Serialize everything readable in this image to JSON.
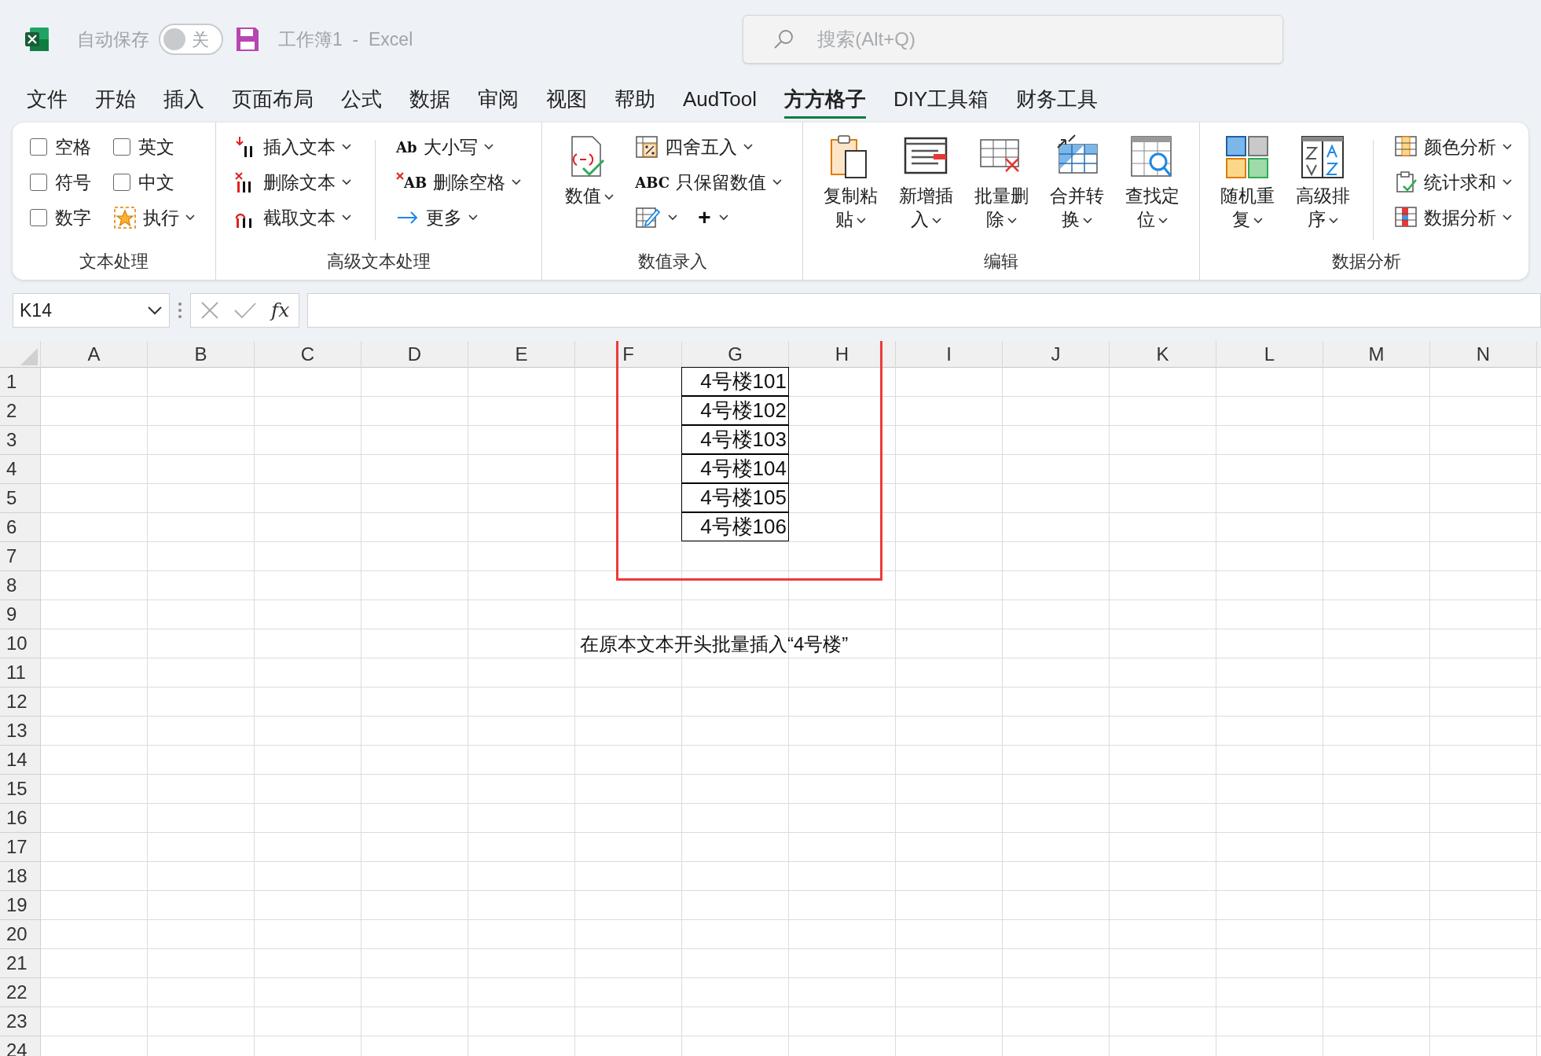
{
  "title_bar": {
    "autosave_label": "自动保存",
    "autosave_toggle": {
      "label": "关",
      "on": false
    },
    "document_title": "工作簿1  -  Excel",
    "search": {
      "placeholder": "搜索(Alt+Q)"
    }
  },
  "menu_tabs": [
    {
      "label": "文件",
      "selected": false
    },
    {
      "label": "开始",
      "selected": false
    },
    {
      "label": "插入",
      "selected": false
    },
    {
      "label": "页面布局",
      "selected": false
    },
    {
      "label": "公式",
      "selected": false
    },
    {
      "label": "数据",
      "selected": false
    },
    {
      "label": "审阅",
      "selected": false
    },
    {
      "label": "视图",
      "selected": false
    },
    {
      "label": "帮助",
      "selected": false
    },
    {
      "label": "AudTool",
      "selected": false
    },
    {
      "label": "方方格子",
      "selected": true
    },
    {
      "label": "DIY工具箱",
      "selected": false
    },
    {
      "label": "财务工具",
      "selected": false
    }
  ],
  "ribbon_groups": [
    {
      "label": "文本处理",
      "columns": [
        [
          {
            "kind": "checkbox",
            "label": "空格",
            "checked": false
          },
          {
            "kind": "checkbox",
            "label": "符号",
            "checked": false
          },
          {
            "kind": "checkbox",
            "label": "数字",
            "checked": false
          }
        ],
        [
          {
            "kind": "checkbox",
            "label": "英文",
            "checked": false
          },
          {
            "kind": "checkbox",
            "label": "中文",
            "checked": false
          },
          {
            "kind": "small",
            "label": "执行"
          }
        ]
      ]
    },
    {
      "label": "高级文本处理",
      "columns": [
        [
          {
            "kind": "small",
            "label": "插入文本"
          },
          {
            "kind": "small",
            "label": "删除文本"
          },
          {
            "kind": "small",
            "label": "截取文本"
          }
        ],
        [
          {
            "kind": "small",
            "label": "大小写",
            "icon_text": "Ab"
          },
          {
            "kind": "small",
            "label": "删除空格",
            "icon_text": "AB"
          },
          {
            "kind": "small",
            "label": "更多"
          }
        ]
      ]
    },
    {
      "label": "数值录入",
      "columns": [
        [
          {
            "kind": "large",
            "label": "数值"
          }
        ],
        [
          {
            "kind": "small",
            "label": "四舍五入"
          },
          {
            "kind": "small",
            "label": "只保留数值",
            "icon_text": "ABC"
          },
          {
            "kind": "icon_menu_row",
            "items": [
              {
                "kind": "icon_menu"
              },
              {
                "kind": "icon_menu",
                "symbol": "+"
              }
            ]
          }
        ]
      ]
    },
    {
      "label": "编辑",
      "columns": [
        [
          {
            "kind": "large",
            "label": "复制粘贴"
          }
        ],
        [
          {
            "kind": "large",
            "label": "新增插入"
          }
        ],
        [
          {
            "kind": "large",
            "label": "批量删除"
          }
        ],
        [
          {
            "kind": "large",
            "label": "合并转换"
          }
        ],
        [
          {
            "kind": "large",
            "label": "查找定位"
          }
        ]
      ]
    },
    {
      "label": "数据分析",
      "columns": [
        [
          {
            "kind": "large",
            "label": "随机重复"
          }
        ],
        [
          {
            "kind": "large",
            "label": "高级排序"
          }
        ],
        [
          {
            "kind": "small",
            "label": "颜色分析"
          },
          {
            "kind": "small",
            "label": "统计求和"
          },
          {
            "kind": "small",
            "label": "数据分析"
          }
        ]
      ]
    }
  ],
  "formula_bar": {
    "name_box": "K14",
    "function_label": "fx"
  },
  "sheet": {
    "columns": [
      "A",
      "B",
      "C",
      "D",
      "E",
      "F",
      "G",
      "H",
      "I",
      "J",
      "K",
      "L",
      "M",
      "N"
    ],
    "rows": [
      {
        "label": "1",
        "cell_g": {
          "text": "4号楼101",
          "bordered": true
        }
      },
      {
        "label": "2",
        "cell_g": {
          "text": "4号楼102",
          "bordered": true
        }
      },
      {
        "label": "3",
        "cell_g": {
          "text": "4号楼103",
          "bordered": true
        }
      },
      {
        "label": "4",
        "cell_g": {
          "text": "4号楼104",
          "bordered": true
        }
      },
      {
        "label": "5",
        "cell_g": {
          "text": "4号楼105",
          "bordered": true
        }
      },
      {
        "label": "6",
        "cell_g": {
          "text": "4号楼106",
          "bordered": true
        }
      },
      {
        "label": "7"
      },
      {
        "label": "8"
      },
      {
        "label": "9"
      },
      {
        "label": "10",
        "cell_f": {
          "text": "在原本文本开头批量插入“4号楼”"
        }
      },
      {
        "label": "11"
      },
      {
        "label": "12"
      },
      {
        "label": "13"
      },
      {
        "label": "14"
      },
      {
        "label": "15"
      },
      {
        "label": "16"
      },
      {
        "label": "17"
      },
      {
        "label": "18"
      },
      {
        "label": "19"
      },
      {
        "label": "20"
      },
      {
        "label": "21"
      },
      {
        "label": "22"
      },
      {
        "label": "23"
      },
      {
        "label": "24"
      }
    ]
  }
}
